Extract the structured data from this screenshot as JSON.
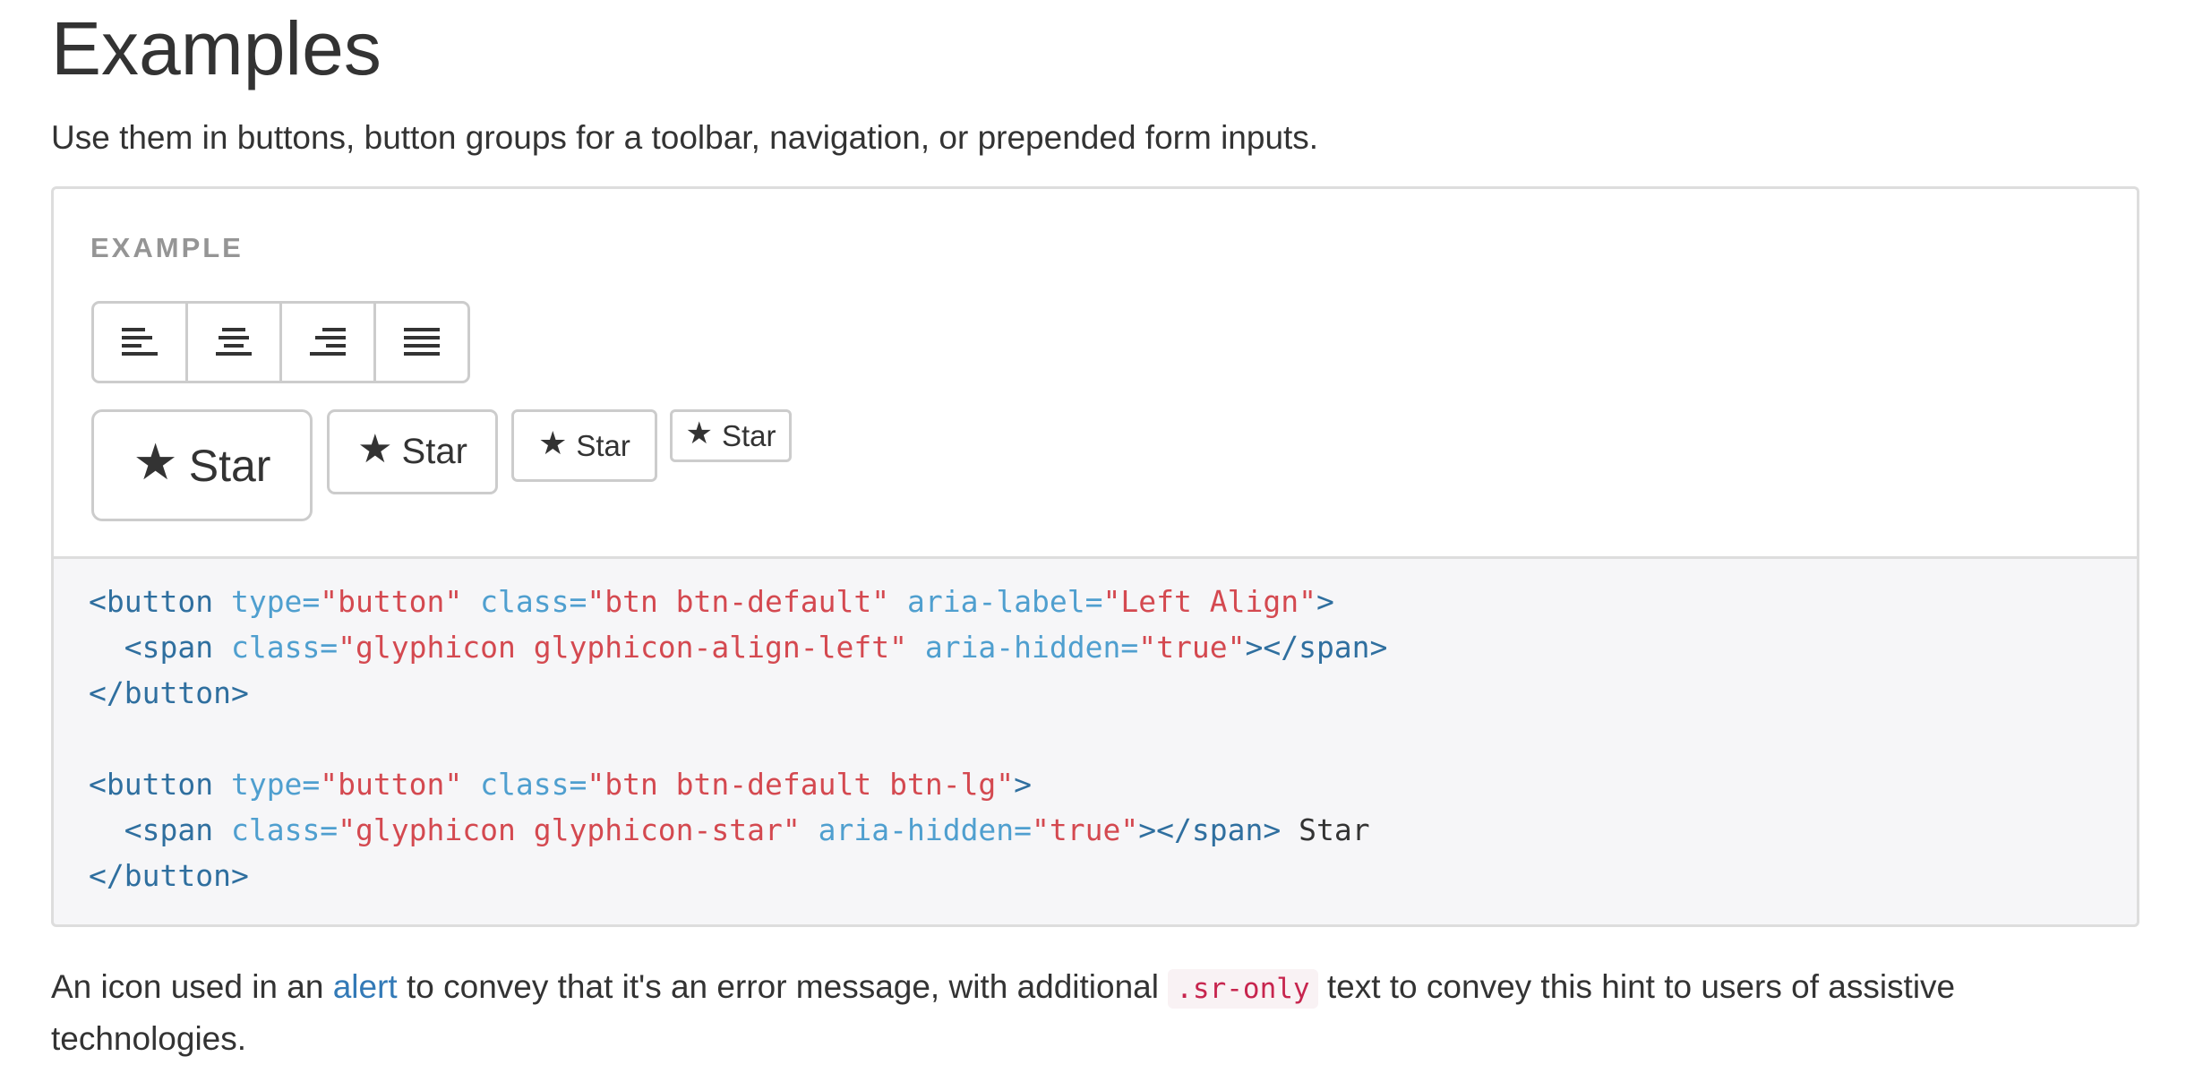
{
  "title": "Examples",
  "lead": "Use them in buttons, button groups for a toolbar, navigation, or prepended form inputs.",
  "example": {
    "label": "EXAMPLE",
    "align_buttons": [
      {
        "icon": "align-left-icon"
      },
      {
        "icon": "align-center-icon"
      },
      {
        "icon": "align-right-icon"
      },
      {
        "icon": "align-justify-icon"
      }
    ],
    "star_buttons": [
      {
        "size": "lg",
        "label": "Star"
      },
      {
        "size": "default",
        "label": "Star"
      },
      {
        "size": "sm",
        "label": "Star"
      },
      {
        "size": "xs",
        "label": "Star"
      }
    ],
    "star_glyph": "★"
  },
  "code": {
    "lines": [
      [
        [
          "tag",
          "<button "
        ],
        [
          "attr",
          "type="
        ],
        [
          "str",
          "\"button\""
        ],
        [
          "txt",
          " "
        ],
        [
          "attr",
          "class="
        ],
        [
          "str",
          "\"btn btn-default\""
        ],
        [
          "txt",
          " "
        ],
        [
          "attr",
          "aria-label="
        ],
        [
          "str",
          "\"Left Align\""
        ],
        [
          "tag",
          ">"
        ]
      ],
      [
        [
          "txt",
          "  "
        ],
        [
          "tag",
          "<span "
        ],
        [
          "attr",
          "class="
        ],
        [
          "str",
          "\"glyphicon glyphicon-align-left\""
        ],
        [
          "txt",
          " "
        ],
        [
          "attr",
          "aria-hidden="
        ],
        [
          "str",
          "\"true\""
        ],
        [
          "tag",
          "></span>"
        ]
      ],
      [
        [
          "tag",
          "</button>"
        ]
      ],
      [
        [
          "txt",
          ""
        ]
      ],
      [
        [
          "tag",
          "<button "
        ],
        [
          "attr",
          "type="
        ],
        [
          "str",
          "\"button\""
        ],
        [
          "txt",
          " "
        ],
        [
          "attr",
          "class="
        ],
        [
          "str",
          "\"btn btn-default btn-lg\""
        ],
        [
          "tag",
          ">"
        ]
      ],
      [
        [
          "txt",
          "  "
        ],
        [
          "tag",
          "<span "
        ],
        [
          "attr",
          "class="
        ],
        [
          "str",
          "\"glyphicon glyphicon-star\""
        ],
        [
          "txt",
          " "
        ],
        [
          "attr",
          "aria-hidden="
        ],
        [
          "str",
          "\"true\""
        ],
        [
          "tag",
          "></span>"
        ],
        [
          "txt",
          " Star"
        ]
      ],
      [
        [
          "tag",
          "</button>"
        ]
      ]
    ]
  },
  "after": {
    "before_link": "An icon used in an ",
    "link": "alert",
    "middle": " to convey that it's an error message, with additional ",
    "code": ".sr-only",
    "after_code": " text to convey this hint to users of assistive technologies."
  }
}
